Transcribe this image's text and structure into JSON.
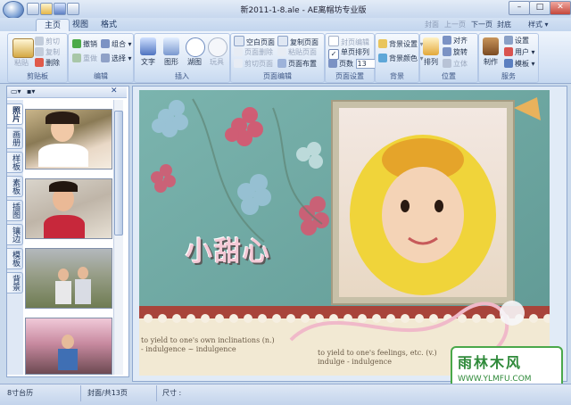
{
  "window": {
    "title": "新2011-1-8.ale - AE离帽坊专业版"
  },
  "quick_access": [
    "new-icon",
    "open-icon",
    "save-icon",
    "undo-icon"
  ],
  "tabs": [
    {
      "label": "主页",
      "active": true
    },
    {
      "label": "视图"
    },
    {
      "label": "格式"
    }
  ],
  "nav": {
    "cover": "封面",
    "prev": "上一页",
    "next": "下一页",
    "back_cover": "封底",
    "style": "样式"
  },
  "ribbon": {
    "clipboard": {
      "label": "剪贴板",
      "paste": "粘贴",
      "cut": "剪切",
      "copy": "复制",
      "delete": "删除"
    },
    "edit": {
      "label": "编辑",
      "undo": "撤销",
      "redo": "重做",
      "group": "组合",
      "select": "选择"
    },
    "insert": {
      "label": "插入",
      "text": "文字",
      "shape": "图形",
      "bubble": "湖图",
      "frame": "玩具"
    },
    "page_edit": {
      "label": "页面编辑",
      "blank_page": "空白页面",
      "copy_page": "复制页面",
      "delete_page": "页面删除",
      "paste_page": "粘贴页面",
      "cut_page": "剪切页面",
      "layout": "页面布置"
    },
    "page_setup": {
      "label": "页面设置",
      "cover_edit": "封页编辑",
      "single_page": "单页排列",
      "pages_label": "页数",
      "pages_value": "13"
    },
    "background": {
      "label": "背景",
      "bg_settings": "背景设置",
      "bg_color": "背景颜色"
    },
    "position": {
      "label": "位置",
      "arrange": "排列",
      "align": "对齐",
      "rotate": "旋转",
      "stand": "立体"
    },
    "service": {
      "label": "服务",
      "make": "制作",
      "settings": "设置",
      "user": "用户",
      "template": "模板"
    }
  },
  "left_panel": {
    "vertical_tabs": [
      {
        "label": "照片",
        "active": true
      },
      {
        "label": "画册"
      },
      {
        "label": "样板"
      },
      {
        "label": "素板"
      },
      {
        "label": "插图"
      },
      {
        "label": "镶边"
      },
      {
        "label": "模板"
      },
      {
        "label": "背景"
      }
    ],
    "thumbnails": [
      "photo-girl-smiling",
      "photo-girl-laughing",
      "photo-two-girls-garden",
      "photo-girl-blossoms"
    ]
  },
  "canvas": {
    "page_title": "小甜心",
    "vocab_lines": [
      "to yield to one's own inclinations (n.)",
      "- indulgence  ~ indulgence",
      "to yield to one's feelings, etc. (v.)",
      "indulge - indulgence"
    ],
    "watermark": {
      "name": "雨林木风",
      "url": "WWW.YLMFU.COM"
    }
  },
  "status": {
    "folder": "8寸台历",
    "page_info": "封面/共13页",
    "size_label": "尺寸 :"
  },
  "colors": {
    "ribbon_bg": "#d5e3f5",
    "page_teal": "#6fa7a3",
    "title_pink": "#f4c9d6"
  }
}
